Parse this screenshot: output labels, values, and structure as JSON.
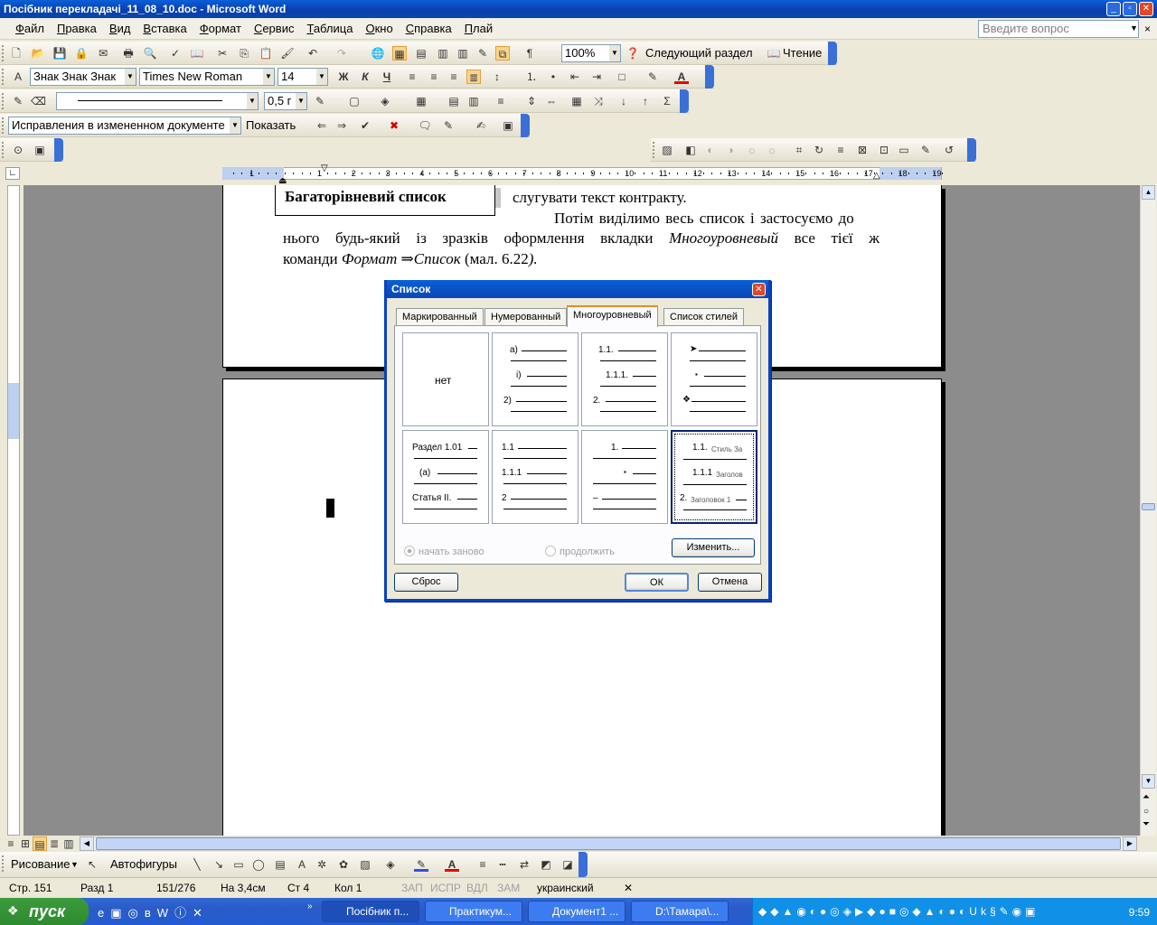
{
  "window": {
    "title": "Посібник перекладачі_11_08_10.doc - Microsoft Word"
  },
  "menu": [
    "Файл",
    "Правка",
    "Вид",
    "Вставка",
    "Формат",
    "Сервис",
    "Таблица",
    "Окно",
    "Справка",
    "Плай"
  ],
  "help_placeholder": "Введите вопрос",
  "toolbar_standard": {
    "zoom": "100%",
    "next_section": "Следующий раздел",
    "reading": "Чтение"
  },
  "toolbar_format": {
    "style": "Знак Знак Знак",
    "font": "Times New Roman",
    "size": "14"
  },
  "toolbar_tables": {
    "line_weight": "0,5 г"
  },
  "toolbar_review": {
    "mode": "Исправления в измененном документе",
    "show": "Показать"
  },
  "ruler": {
    "numbers": [
      "1",
      "1",
      "2",
      "3",
      "4",
      "5",
      "6",
      "7",
      "8",
      "9",
      "10",
      "11",
      "12",
      "13",
      "14",
      "15",
      "16",
      "17",
      "18",
      "19"
    ]
  },
  "document": {
    "boxed_heading": "Багаторівневий список",
    "line1": "слугувати текст контракту.",
    "line2": "Потім виділимо весь список і застосуємо до",
    "line3a": "нього будь-який із зразків оформлення вкладки ",
    "line3b": "Многоуровневый",
    "line3c": " все тієї ж",
    "line4a": "команди ",
    "line4b": "Формат ⇒Список",
    "line4c": " (мал. 6.22",
    "line4d": ").",
    "line4e": "."
  },
  "dialog": {
    "title": "Список",
    "tabs": [
      "Маркированный",
      "Нумерованный",
      "Многоуровневый",
      "Список стилей"
    ],
    "active_tab": "Многоуровневый",
    "none_label": "нет",
    "cells": {
      "c2": [
        "a)",
        "i)",
        "2)"
      ],
      "c3": [
        "1.1.",
        "1.1.1.",
        "2."
      ],
      "c4": [
        "➤",
        "▪",
        "❖"
      ],
      "c5": [
        "Раздел 1.01",
        "(а)",
        "Статья II."
      ],
      "c6": [
        "1.1",
        "1.1.1",
        "2"
      ],
      "c7": [
        "1.",
        "▪",
        "–"
      ],
      "c8": [
        "1.1.",
        "Стиль За",
        "1.1.1",
        "Заголов",
        "2.",
        "Заголовок 1"
      ]
    },
    "restart": "начать заново",
    "continue": "продолжить",
    "modify": "Изменить...",
    "reset": "Сброс",
    "ok": "ОК",
    "cancel": "Отмена"
  },
  "drawing": {
    "draw": "Рисование",
    "autoshapes": "Автофигуры"
  },
  "status": {
    "page": "Стр. 151",
    "section": "Разд 1",
    "pages": "151/276",
    "at": "На 3,4см",
    "line": "Ст 4",
    "col": "Кол 1",
    "rec": "ЗАП",
    "trk": "ИСПР",
    "ext": "ВДЛ",
    "ovr": "ЗАМ",
    "lang": "украинский"
  },
  "taskbar": {
    "start": "пуск",
    "tasks": [
      "Посібник п...",
      "Практикум...",
      "Документ1 ...",
      "D:\\Тамара\\..."
    ],
    "clock": "9:59"
  }
}
